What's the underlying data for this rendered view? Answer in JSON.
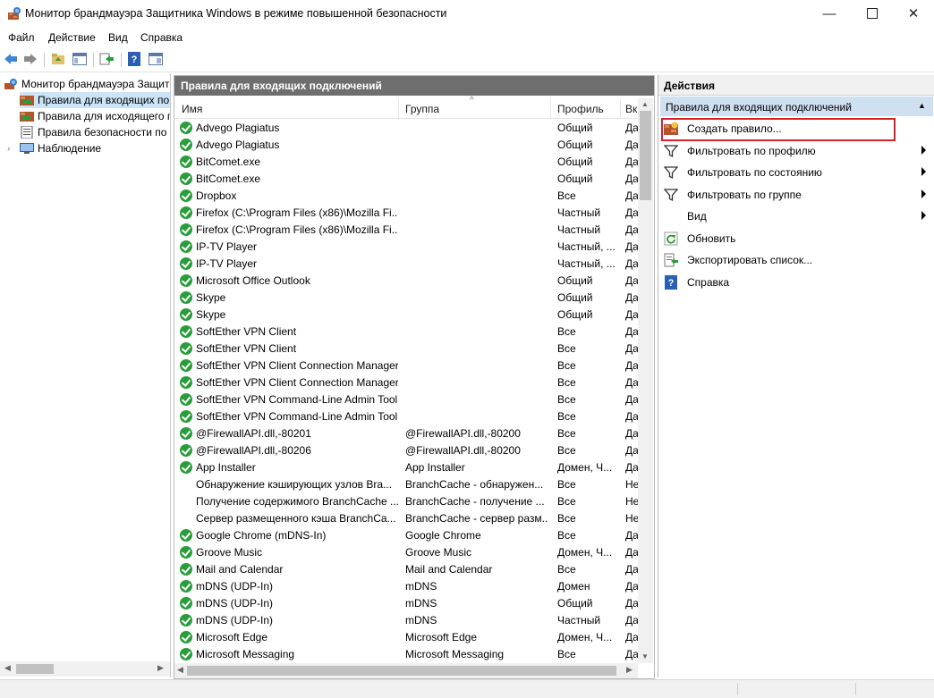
{
  "window": {
    "title": "Монитор брандмауэра Защитника Windows в режиме повышенной безопасности"
  },
  "menu": {
    "items": [
      "Файл",
      "Действие",
      "Вид",
      "Справка"
    ]
  },
  "tree": {
    "root": "Монитор брандмауэра Защит",
    "items": [
      "Правила для входящих по",
      "Правила для исходящего п",
      "Правила безопасности по",
      "Наблюдение"
    ]
  },
  "center": {
    "title": "Правила для входящих подключений",
    "columns": [
      "Имя",
      "Группа",
      "Профиль",
      "Вк"
    ],
    "rows": [
      {
        "name": "Advego Plagiatus",
        "group": "",
        "profile": "Общий",
        "enabled": "Да",
        "icon": "allow-icon"
      },
      {
        "name": "Advego Plagiatus",
        "group": "",
        "profile": "Общий",
        "enabled": "Да",
        "icon": "allow-icon"
      },
      {
        "name": "BitComet.exe",
        "group": "",
        "profile": "Общий",
        "enabled": "Да",
        "icon": "allow-icon"
      },
      {
        "name": "BitComet.exe",
        "group": "",
        "profile": "Общий",
        "enabled": "Да",
        "icon": "allow-icon"
      },
      {
        "name": "Dropbox",
        "group": "",
        "profile": "Все",
        "enabled": "Да",
        "icon": "allow-icon"
      },
      {
        "name": "Firefox (C:\\Program Files (x86)\\Mozilla Fi...",
        "group": "",
        "profile": "Частный",
        "enabled": "Да",
        "icon": "allow-icon"
      },
      {
        "name": "Firefox (C:\\Program Files (x86)\\Mozilla Fi...",
        "group": "",
        "profile": "Частный",
        "enabled": "Да",
        "icon": "allow-icon"
      },
      {
        "name": "IP-TV Player",
        "group": "",
        "profile": "Частный, ...",
        "enabled": "Да",
        "icon": "allow-icon"
      },
      {
        "name": "IP-TV Player",
        "group": "",
        "profile": "Частный, ...",
        "enabled": "Да",
        "icon": "allow-icon"
      },
      {
        "name": "Microsoft Office Outlook",
        "group": "",
        "profile": "Общий",
        "enabled": "Да",
        "icon": "allow-icon"
      },
      {
        "name": "Skype",
        "group": "",
        "profile": "Общий",
        "enabled": "Да",
        "icon": "allow-icon"
      },
      {
        "name": "Skype",
        "group": "",
        "profile": "Общий",
        "enabled": "Да",
        "icon": "allow-icon"
      },
      {
        "name": "SoftEther VPN Client",
        "group": "",
        "profile": "Все",
        "enabled": "Да",
        "icon": "allow-icon"
      },
      {
        "name": "SoftEther VPN Client",
        "group": "",
        "profile": "Все",
        "enabled": "Да",
        "icon": "allow-icon"
      },
      {
        "name": "SoftEther VPN Client Connection Manager",
        "group": "",
        "profile": "Все",
        "enabled": "Да",
        "icon": "allow-icon"
      },
      {
        "name": "SoftEther VPN Client Connection Manager",
        "group": "",
        "profile": "Все",
        "enabled": "Да",
        "icon": "allow-icon"
      },
      {
        "name": "SoftEther VPN Command-Line Admin Tool",
        "group": "",
        "profile": "Все",
        "enabled": "Да",
        "icon": "allow-icon"
      },
      {
        "name": "SoftEther VPN Command-Line Admin Tool",
        "group": "",
        "profile": "Все",
        "enabled": "Да",
        "icon": "allow-icon"
      },
      {
        "name": "@FirewallAPI.dll,-80201",
        "group": "@FirewallAPI.dll,-80200",
        "profile": "Все",
        "enabled": "Да",
        "icon": "allow-icon"
      },
      {
        "name": "@FirewallAPI.dll,-80206",
        "group": "@FirewallAPI.dll,-80200",
        "profile": "Все",
        "enabled": "Да",
        "icon": "allow-icon"
      },
      {
        "name": "App Installer",
        "group": "App Installer",
        "profile": "Домен, Ч...",
        "enabled": "Да",
        "icon": "allow-icon"
      },
      {
        "name": "Обнаружение кэширующих узлов Bra...",
        "group": "BranchCache - обнаружен...",
        "profile": "Все",
        "enabled": "Не",
        "icon": ""
      },
      {
        "name": "Получение содержимого BranchCache ...",
        "group": "BranchCache - получение ...",
        "profile": "Все",
        "enabled": "Не",
        "icon": ""
      },
      {
        "name": "Сервер размещенного кэша BranchCa...",
        "group": "BranchCache - сервер разм...",
        "profile": "Все",
        "enabled": "Не",
        "icon": ""
      },
      {
        "name": "Google Chrome (mDNS-In)",
        "group": "Google Chrome",
        "profile": "Все",
        "enabled": "Да",
        "icon": "allow-icon"
      },
      {
        "name": "Groove Music",
        "group": "Groove Music",
        "profile": "Домен, Ч...",
        "enabled": "Да",
        "icon": "allow-icon"
      },
      {
        "name": "Mail and Calendar",
        "group": "Mail and Calendar",
        "profile": "Все",
        "enabled": "Да",
        "icon": "allow-icon"
      },
      {
        "name": "mDNS (UDP-In)",
        "group": "mDNS",
        "profile": "Домен",
        "enabled": "Да",
        "icon": "allow-icon"
      },
      {
        "name": "mDNS (UDP-In)",
        "group": "mDNS",
        "profile": "Общий",
        "enabled": "Да",
        "icon": "allow-icon"
      },
      {
        "name": "mDNS (UDP-In)",
        "group": "mDNS",
        "profile": "Частный",
        "enabled": "Да",
        "icon": "allow-icon"
      },
      {
        "name": "Microsoft Edge",
        "group": "Microsoft Edge",
        "profile": "Домен, Ч...",
        "enabled": "Да",
        "icon": "allow-icon"
      },
      {
        "name": "Microsoft Messaging",
        "group": "Microsoft Messaging",
        "profile": "Все",
        "enabled": "Да",
        "icon": "allow-icon"
      }
    ]
  },
  "actions": {
    "title": "Действия",
    "section": "Правила для входящих подключений",
    "items": [
      {
        "label": "Создать правило...",
        "icon": "new-rule-icon",
        "submenu": false
      },
      {
        "label": "Фильтровать по профилю",
        "icon": "filter-icon",
        "submenu": true
      },
      {
        "label": "Фильтровать по состоянию",
        "icon": "filter-icon",
        "submenu": true
      },
      {
        "label": "Фильтровать по группе",
        "icon": "filter-icon",
        "submenu": true
      },
      {
        "label": "Вид",
        "icon": "",
        "submenu": true
      },
      {
        "label": "Обновить",
        "icon": "refresh-icon",
        "submenu": false
      },
      {
        "label": "Экспортировать список...",
        "icon": "export-icon",
        "submenu": false
      },
      {
        "label": "Справка",
        "icon": "help-icon",
        "submenu": false
      }
    ]
  },
  "colors": {
    "header_bg": "#6e6e6e",
    "selection": "#cfe0f1",
    "allow_green": "#2a9d3b",
    "highlight_red": "#d6232c"
  }
}
